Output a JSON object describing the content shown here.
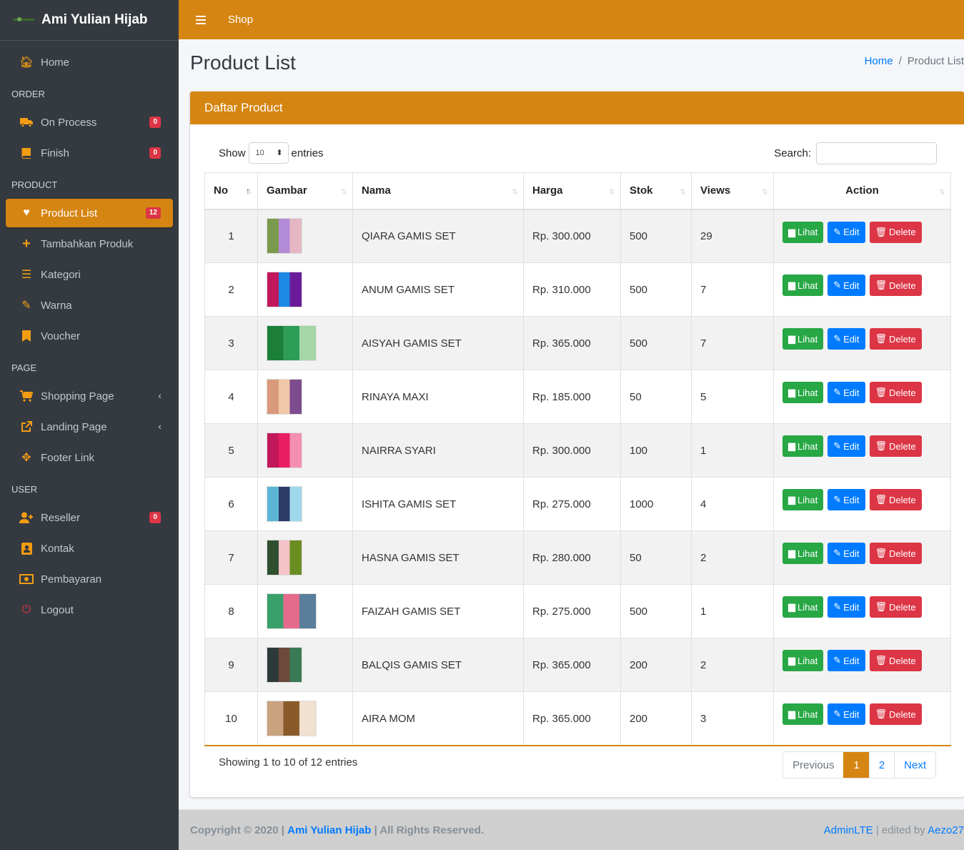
{
  "brand": {
    "name": "Ami Yulian Hijab"
  },
  "topbar": {
    "link": "Shop"
  },
  "sidebar": {
    "home": "Home",
    "sections": {
      "order": "ORDER",
      "product": "PRODUCT",
      "page": "PAGE",
      "user": "USER"
    },
    "items": {
      "on_process": {
        "label": "On Process",
        "badge": "0"
      },
      "finish": {
        "label": "Finish",
        "badge": "0"
      },
      "product_list": {
        "label": "Product List",
        "badge": "12"
      },
      "tambahkan_produk": {
        "label": "Tambahkan Produk"
      },
      "kategori": {
        "label": "Kategori"
      },
      "warna": {
        "label": "Warna"
      },
      "voucher": {
        "label": "Voucher"
      },
      "shopping_page": {
        "label": "Shopping Page"
      },
      "landing_page": {
        "label": "Landing Page"
      },
      "footer_link": {
        "label": "Footer Link"
      },
      "reseller": {
        "label": "Reseller",
        "badge": "0"
      },
      "kontak": {
        "label": "Kontak"
      },
      "pembayaran": {
        "label": "Pembayaran"
      },
      "logout": {
        "label": "Logout"
      }
    }
  },
  "content": {
    "title": "Product List",
    "breadcrumb": {
      "home": "Home",
      "separator": "/",
      "current": "Product List"
    }
  },
  "card": {
    "title": "Daftar Product",
    "show_label": "Show",
    "show_value": "10",
    "entries_label": "entries",
    "search_label": "Search:",
    "search_value": ""
  },
  "table": {
    "columns": [
      "No",
      "Gambar",
      "Nama",
      "Harga",
      "Stok",
      "Views",
      "Action"
    ],
    "rows": [
      {
        "no": "1",
        "nama": "QIARA GAMIS SET",
        "harga": "Rp. 300.000",
        "stok": "500",
        "views": "29"
      },
      {
        "no": "2",
        "nama": "ANUM GAMIS SET",
        "harga": "Rp. 310.000",
        "stok": "500",
        "views": "7"
      },
      {
        "no": "3",
        "nama": "AISYAH GAMIS SET",
        "harga": "Rp. 365.000",
        "stok": "500",
        "views": "7"
      },
      {
        "no": "4",
        "nama": "RINAYA MAXI",
        "harga": "Rp. 185.000",
        "stok": "50",
        "views": "5"
      },
      {
        "no": "5",
        "nama": "NAIRRA SYARI",
        "harga": "Rp. 300.000",
        "stok": "100",
        "views": "1"
      },
      {
        "no": "6",
        "nama": "ISHITA GAMIS SET",
        "harga": "Rp. 275.000",
        "stok": "1000",
        "views": "4"
      },
      {
        "no": "7",
        "nama": "HASNA GAMIS SET",
        "harga": "Rp. 280.000",
        "stok": "50",
        "views": "2"
      },
      {
        "no": "8",
        "nama": "FAIZAH GAMIS SET",
        "harga": "Rp. 275.000",
        "stok": "500",
        "views": "1"
      },
      {
        "no": "9",
        "nama": "BALQIS GAMIS SET",
        "harga": "Rp. 365.000",
        "stok": "200",
        "views": "2"
      },
      {
        "no": "10",
        "nama": "AIRA MOM",
        "harga": "Rp. 365.000",
        "stok": "200",
        "views": "3"
      }
    ],
    "buttons": {
      "view": "Lihat",
      "edit": "Edit",
      "delete": "Delete"
    }
  },
  "pagination": {
    "info": "Showing 1 to 10 of 12 entries",
    "previous": "Previous",
    "pages": [
      "1",
      "2"
    ],
    "next": "Next"
  },
  "footer": {
    "copyright": "Copyright © 2020 |",
    "brand_link": "Ami Yulian Hijab",
    "rights": "| All Rights Reserved.",
    "adminlte": "AdminLTE",
    "edited_by": "| edited by",
    "author": "Aezo27"
  },
  "colors": {
    "accent": "#d58512",
    "sidebar": "#343a40",
    "success": "#28a745",
    "primary": "#007bff",
    "danger": "#dc3545"
  }
}
